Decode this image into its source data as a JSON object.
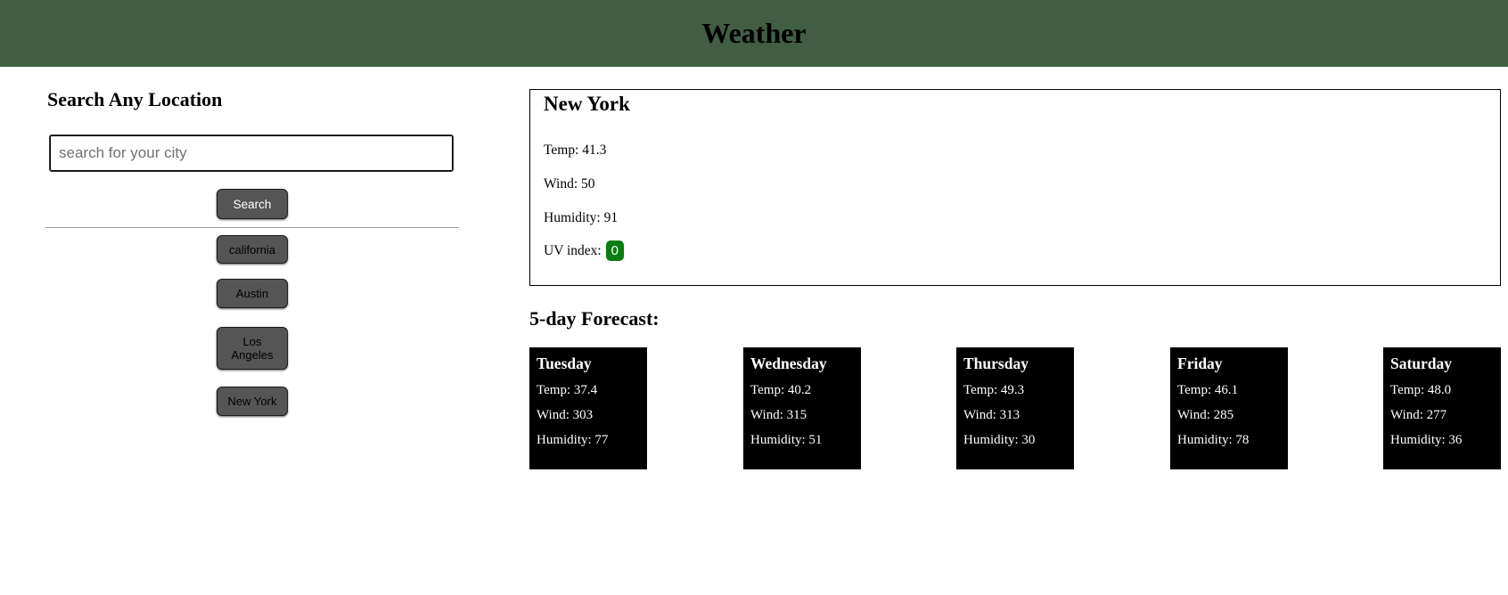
{
  "header": {
    "title": "Weather"
  },
  "sidebar": {
    "heading": "Search Any Location",
    "search_placeholder": "search for your city",
    "search_button": "Search",
    "history": [
      "california",
      "Austin",
      "Los Angeles",
      "New York"
    ]
  },
  "current": {
    "city": "New York",
    "temp": "Temp: 41.3",
    "wind": "Wind: 50",
    "humidity": "Humidity: 91",
    "uv_label": "UV index:",
    "uv_value": "0",
    "uv_color": "#0a7d12"
  },
  "forecast": {
    "title": "5-day Forecast:",
    "days": [
      {
        "day": "Tuesday",
        "temp": "Temp: 37.4",
        "wind": "Wind: 303",
        "humidity": "Humidity: 77"
      },
      {
        "day": "Wednesday",
        "temp": "Temp: 40.2",
        "wind": "Wind: 315",
        "humidity": "Humidity: 51"
      },
      {
        "day": "Thursday",
        "temp": "Temp: 49.3",
        "wind": "Wind: 313",
        "humidity": "Humidity: 30"
      },
      {
        "day": "Friday",
        "temp": "Temp: 46.1",
        "wind": "Wind: 285",
        "humidity": "Humidity: 78"
      },
      {
        "day": "Saturday",
        "temp": "Temp: 48.0",
        "wind": "Wind: 277",
        "humidity": "Humidity: 36"
      }
    ]
  },
  "colors": {
    "header_bg": "#415e45",
    "button_bg": "#555555",
    "card_bg": "#000000"
  }
}
